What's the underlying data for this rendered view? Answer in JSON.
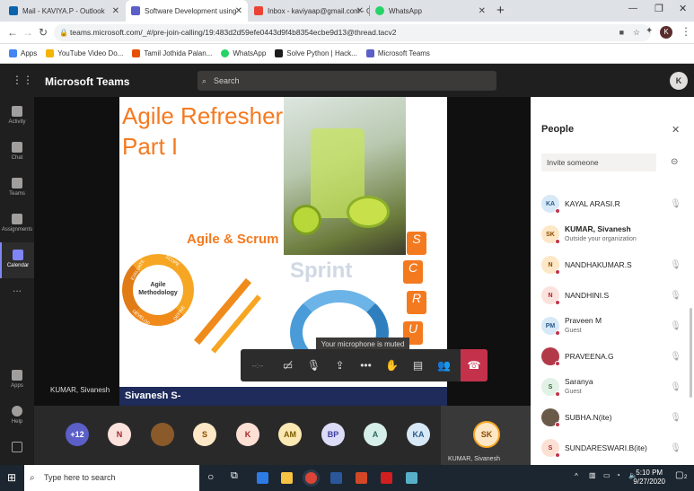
{
  "browser": {
    "tabs": [
      {
        "title": "Mail - KAVIYA.P - Outlook",
        "color": "#0a64ad"
      },
      {
        "title": "Software Development using",
        "color": "#5b5fc7"
      },
      {
        "title": "Inbox - kaviyaap@gmail.com - G",
        "color": "#ea4335"
      },
      {
        "title": "WhatsApp",
        "color": "#25d366"
      }
    ],
    "new_tab": "+",
    "url": "teams.microsoft.com/_#/pre-join-calling/19:483d2d59efe0443d9f4b8354ecbe9d13@thread.tacv2",
    "profile_initial": "K",
    "bookmarks": [
      "Apps",
      "YouTube Video Do...",
      "Tamil Jothida Palan...",
      "WhatsApp",
      "Solve Python | Hack...",
      "Microsoft Teams"
    ]
  },
  "teams": {
    "app_name": "Microsoft Teams",
    "search_placeholder": "Search",
    "user_initial": "K",
    "rail": [
      "Activity",
      "Chat",
      "Teams",
      "Assignments",
      "Calendar",
      "...",
      "Apps",
      "Help"
    ]
  },
  "slide": {
    "title_line1": "Agile Refresher",
    "title_line2": "Part I",
    "subtitle": "Agile & Scrum",
    "wheel_center": "Agile Methodology",
    "wheel_words": [
      "EVALUATE",
      "SCOPE",
      "DEFINE",
      "DEVELOP"
    ],
    "sprint_text": "Sprint",
    "letters": [
      "S",
      "C",
      "R",
      "U"
    ]
  },
  "stage": {
    "presenter_caption": "Sivanesh S-",
    "self_label": "KUMAR, Sivanesh",
    "tooltip": "Your microphone is muted",
    "timer": "--:--"
  },
  "strip": {
    "avatars": [
      {
        "label": "+12",
        "bg": "#5b5fc7",
        "fg": "#fff"
      },
      {
        "label": "N",
        "bg": "#fbe2dc",
        "fg": "#a4262c"
      },
      {
        "label": "",
        "bg": "#8a5a2b",
        "fg": "#fff"
      },
      {
        "label": "S",
        "bg": "#fde7c6",
        "fg": "#8a4b00"
      },
      {
        "label": "K",
        "bg": "#fce0d4",
        "fg": "#a4262c"
      },
      {
        "label": "AM",
        "bg": "#fce8b2",
        "fg": "#7a5b00"
      },
      {
        "label": "BP",
        "bg": "#dcdcf8",
        "fg": "#3d3d9e"
      },
      {
        "label": "A",
        "bg": "#d6efe9",
        "fg": "#2d6b5c"
      },
      {
        "label": "KA",
        "bg": "#d7e8f7",
        "fg": "#2a5b8a"
      }
    ],
    "self": {
      "label": "SK",
      "name": "KUMAR, Sivanesh"
    }
  },
  "people": {
    "title": "People",
    "invite_placeholder": "Invite someone",
    "list": [
      {
        "initials": "KA",
        "name": "KAYAL ARASI.R",
        "sub": "",
        "bg": "#d7e8f7",
        "fg": "#2a5b8a",
        "muted": true
      },
      {
        "initials": "SK",
        "name": "KUMAR, Sivanesh",
        "sub": "Outside your organization",
        "bg": "#fde7c6",
        "fg": "#8a4b00",
        "muted": false
      },
      {
        "initials": "N",
        "name": "NANDHAKUMAR.S",
        "sub": "",
        "bg": "#fde7c6",
        "fg": "#8a4b00",
        "muted": true
      },
      {
        "initials": "N",
        "name": "NANDHINI.S",
        "sub": "",
        "bg": "#fbe2dc",
        "fg": "#a4262c",
        "muted": true
      },
      {
        "initials": "PM",
        "name": "Praveen M",
        "sub": "Guest",
        "bg": "#d7e8f7",
        "fg": "#2a5b8a",
        "muted": true
      },
      {
        "initials": "",
        "name": "PRAVEENA.G",
        "sub": "",
        "bg": "#b23a48",
        "fg": "#fff",
        "muted": true
      },
      {
        "initials": "S",
        "name": "Saranya",
        "sub": "Guest",
        "bg": "#e2f1e6",
        "fg": "#2d6b3c",
        "muted": true
      },
      {
        "initials": "",
        "name": "SUBHA.N(ite)",
        "sub": "",
        "bg": "#6a5a4a",
        "fg": "#fff",
        "muted": true
      },
      {
        "initials": "S",
        "name": "SUNDARESWARI.B(ite)",
        "sub": "",
        "bg": "#fce0d4",
        "fg": "#a4262c",
        "muted": true
      }
    ]
  },
  "taskbar": {
    "search_placeholder": "Type here to search",
    "time": "5:10 PM",
    "date": "9/27/2020",
    "notification_count": "2"
  }
}
